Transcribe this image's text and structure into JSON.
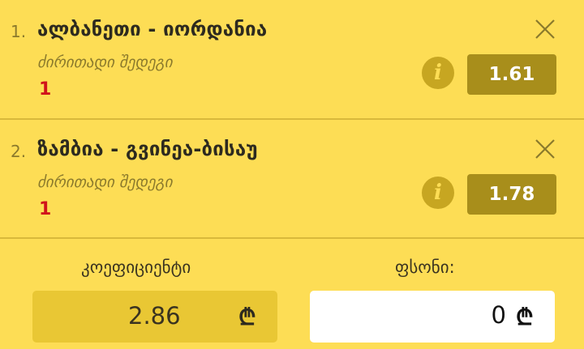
{
  "bets": [
    {
      "index": "1.",
      "match": "ალბანეთი - იორდანია",
      "market": "ძირითადი შედეგი",
      "pick": "1",
      "odds": "1.61",
      "info_icon": "i",
      "close_icon": "close-icon"
    },
    {
      "index": "2.",
      "match": "ზამბია - გვინეა-ბისაუ",
      "market": "ძირითადი შედეგი",
      "pick": "1",
      "odds": "1.78",
      "info_icon": "i",
      "close_icon": "close-icon"
    }
  ],
  "summary": {
    "coefficient_label": "კოეფიციენტი",
    "coefficient_value": "2.86",
    "stake_label": "ფსონი:",
    "stake_value": "0",
    "currency_symbol": "₾"
  },
  "colors": {
    "background": "#fddd55",
    "odds_box": "#a88e1b",
    "pick": "#d0141b",
    "coef_box": "#e9c734"
  }
}
